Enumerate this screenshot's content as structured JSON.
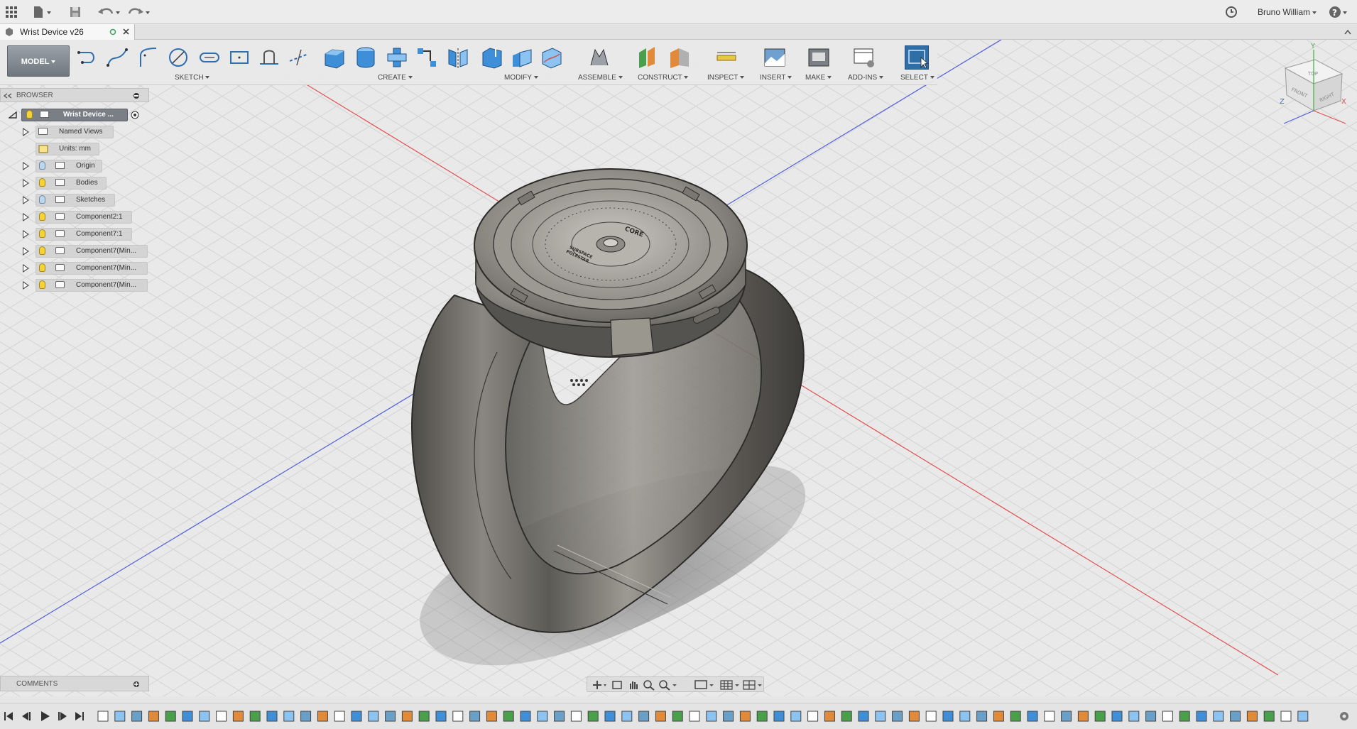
{
  "document": {
    "tab_title": "Wrist Device v26"
  },
  "user": {
    "name": "Bruno William"
  },
  "ribbon": {
    "workspace": "MODEL",
    "groups": [
      {
        "label": "SKETCH"
      },
      {
        "label": "CREATE"
      },
      {
        "label": "MODIFY"
      },
      {
        "label": "ASSEMBLE"
      },
      {
        "label": "CONSTRUCT"
      },
      {
        "label": "INSPECT"
      },
      {
        "label": "INSERT"
      },
      {
        "label": "MAKE"
      },
      {
        "label": "ADD-INS"
      },
      {
        "label": "SELECT"
      }
    ]
  },
  "browser": {
    "title": "BROWSER",
    "root": "Wrist Device ...",
    "items": [
      {
        "label": "Named Views"
      },
      {
        "label": "Units: mm"
      },
      {
        "label": "Origin"
      },
      {
        "label": "Bodies"
      },
      {
        "label": "Sketches"
      },
      {
        "label": "Component2:1"
      },
      {
        "label": "Component7:1"
      },
      {
        "label": "Component7(Min..."
      },
      {
        "label": "Component7(Min..."
      },
      {
        "label": "Component7(Min..."
      }
    ]
  },
  "comments": {
    "title": "COMMENTS"
  },
  "viewcube": {
    "top": "TOP",
    "front": "FRONT",
    "right": "RIGHT",
    "axis_x": "X",
    "axis_y": "Y",
    "axis_z": "Z"
  },
  "model": {
    "dial_text_1": "CORE",
    "dial_text_2": "SUBSPACE",
    "dial_text_3": "POLESTAR"
  },
  "colors": {
    "accent_select": "#2f6fa6",
    "bulb_on": "#f3d23a",
    "bulb_off": "#bcd6ea",
    "axis_red": "#e05050",
    "axis_blue": "#5060d8"
  }
}
